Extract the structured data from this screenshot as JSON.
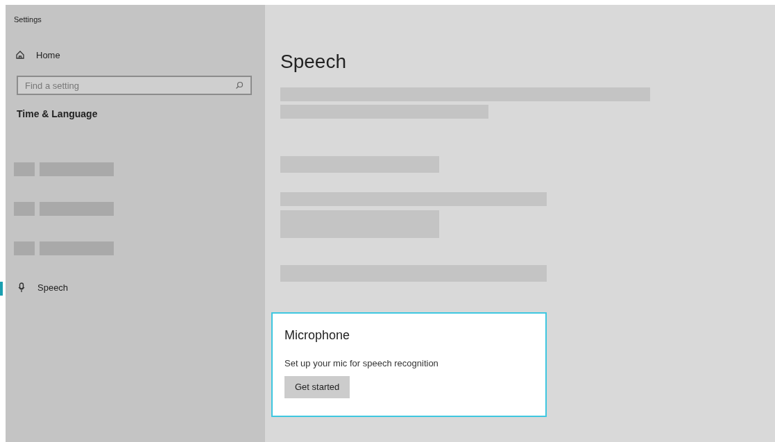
{
  "window": {
    "title": "Settings"
  },
  "sidebar": {
    "home": "Home",
    "search": {
      "placeholder": "Find a setting"
    },
    "section": "Time & Language",
    "items": [
      {
        "kind": "placeholder"
      },
      {
        "kind": "placeholder"
      },
      {
        "kind": "placeholder"
      },
      {
        "kind": "link",
        "label": "Speech",
        "selected": true
      }
    ]
  },
  "page": {
    "title": "Speech",
    "card": {
      "title": "Microphone",
      "text": "Set up your mic for speech recognition",
      "button": "Get started"
    }
  }
}
